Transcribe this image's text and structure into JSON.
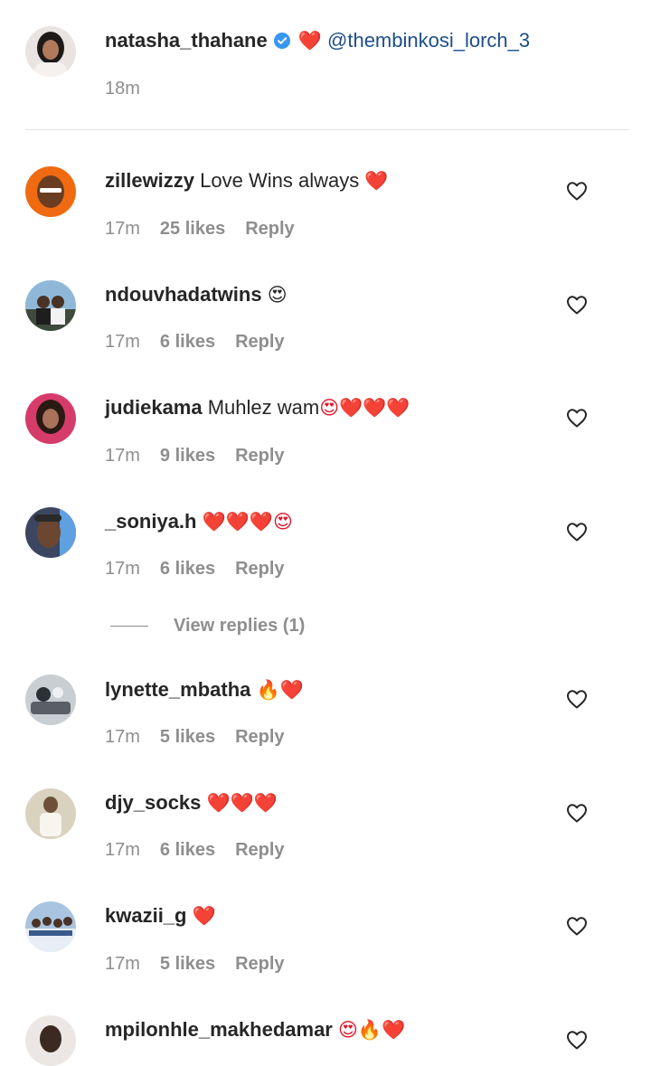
{
  "caption": {
    "username": "natasha_thahane",
    "emoji": "❤️",
    "mention": "@thembinkosi_lorch_3",
    "time": "18m"
  },
  "comments": [
    {
      "username": "zillewizzy",
      "text": "Love Wins always",
      "emoji": "❤️",
      "time": "17m",
      "likes": "25 likes",
      "reply": "Reply"
    },
    {
      "username": "ndouvhadatwins",
      "text": "",
      "emoji": "😍",
      "time": "17m",
      "likes": "6 likes",
      "reply": "Reply"
    },
    {
      "username": "judiekama",
      "text": "Muhlez wam",
      "emoji": "😍❤️❤️❤️",
      "time": "17m",
      "likes": "9 likes",
      "reply": "Reply"
    },
    {
      "username": "_soniya.h",
      "text": "",
      "emoji": "❤️❤️❤️😍",
      "time": "17m",
      "likes": "6 likes",
      "reply": "Reply"
    },
    {
      "username": "lynette_mbatha",
      "text": "",
      "emoji": "🔥❤️",
      "time": "17m",
      "likes": "5 likes",
      "reply": "Reply"
    },
    {
      "username": "djy_socks",
      "text": "",
      "emoji": "❤️❤️❤️",
      "time": "17m",
      "likes": "6 likes",
      "reply": "Reply"
    },
    {
      "username": "kwazii_g",
      "text": "",
      "emoji": "❤️",
      "time": "17m",
      "likes": "5 likes",
      "reply": "Reply"
    },
    {
      "username": "mpilonhle_makhedamar",
      "text": "",
      "emoji": "😍🔥❤️"
    }
  ],
  "view_replies": "View replies (1)",
  "colors": {
    "accent_link": "#1e4e8a",
    "verified": "#3897f0",
    "heart": "#e0152a",
    "muted": "#8e8e8e"
  }
}
